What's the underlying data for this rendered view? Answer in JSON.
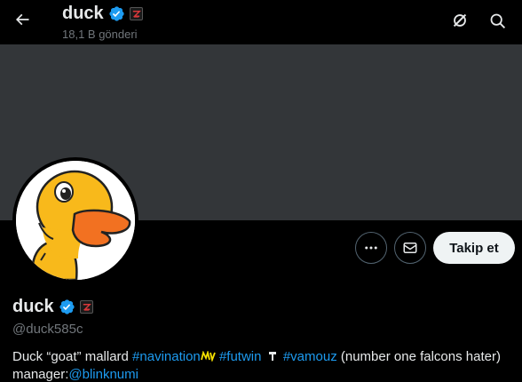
{
  "header": {
    "back_icon": "arrow-left-icon",
    "name": "duck",
    "post_count": "18,1 B gönderi",
    "grok_icon": "grok-slash-icon",
    "search_icon": "search-icon"
  },
  "profile": {
    "name": "duck",
    "handle": "@duck585c",
    "avatar_icon": "yellow-duck-avatar",
    "verified_icon": "verified-badge-icon",
    "affiliate_icon": "affiliate-badge-icon"
  },
  "actions": {
    "more_icon": "more-dots-icon",
    "message_icon": "envelope-icon",
    "follow_label": "Takip et"
  },
  "bio": {
    "text1": "Duck “goat” mallard ",
    "hashtag1": "#navination",
    "hashtag2": "#futwin",
    "hashtag3": "#vamouz",
    "text2": " (number one falcons hater) manager:",
    "mention": "@blinknumi"
  },
  "colors": {
    "accent": "#1d9bf0",
    "background": "#000000",
    "banner": "#333639",
    "muted": "#71767b"
  }
}
